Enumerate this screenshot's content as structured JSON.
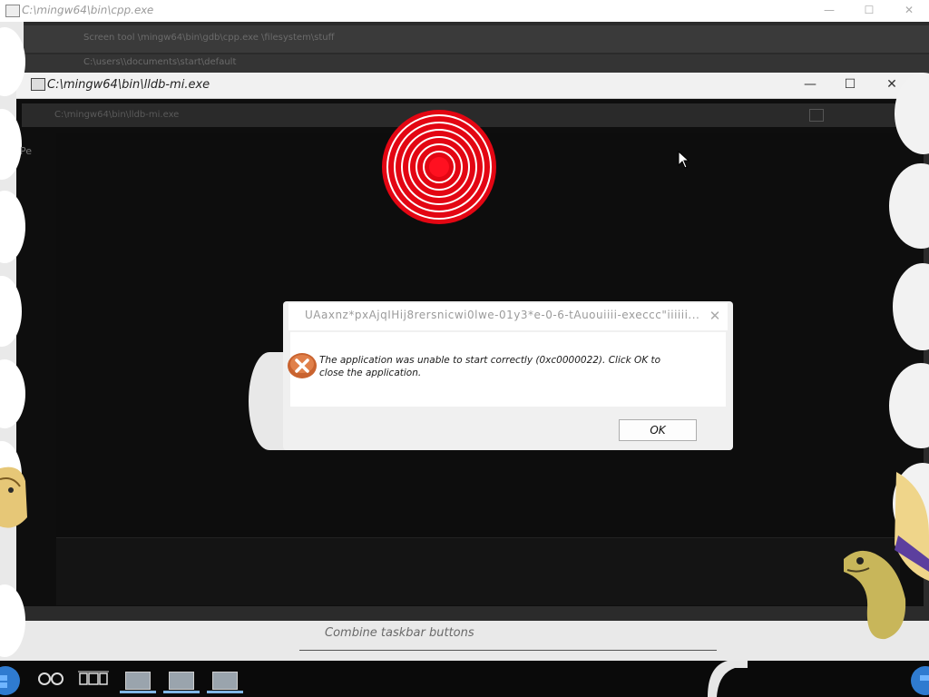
{
  "background_window": {
    "title": "C:\\mingw64\\bin\\cpp.exe",
    "band1_text": "Screen tool \\mingw64\\bin\\gdb\\cpp.exe \\filesystem\\stuff",
    "band2_text": "C:\\users\\\\documents\\start\\default"
  },
  "main_window": {
    "title": "C:\\mingw64\\bin\\lldb-mi.exe",
    "address_text": "C:\\mingw64\\bin\\lldb-mi.exe",
    "minimize": "—",
    "maximize": "☐",
    "close": "✕"
  },
  "left_strip": {
    "text": "Pe"
  },
  "dialog": {
    "title": "UAaxnz*pxAjqIHij8rersnicwi0lwe-01y3*e-0-6-tAuouiiii-execcc\"iiiiii...",
    "close": "✕",
    "message": "The application was unable to start correctly (0xc0000022). Click OK to close the application.",
    "ok_label": "OK"
  },
  "settings": {
    "combine_label": "Combine taskbar buttons"
  },
  "taskbar": {
    "apps": [
      {
        "name": "app-window-1",
        "active": true
      },
      {
        "name": "app-window-2",
        "active": true
      },
      {
        "name": "app-window-3",
        "active": true
      }
    ]
  },
  "colors": {
    "target_red": "#e30613",
    "taskbar_underline": "#7fb6e6",
    "console_bg": "#0d0d0d"
  }
}
